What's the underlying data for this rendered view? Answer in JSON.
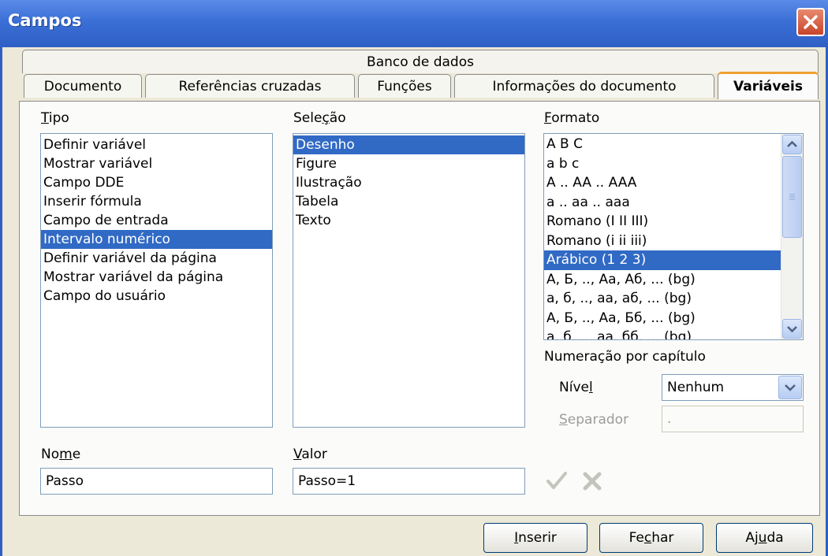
{
  "window": {
    "title": "Campos"
  },
  "tabs_top": [
    {
      "label": "Banco de dados"
    }
  ],
  "tabs": [
    {
      "label": "Documento"
    },
    {
      "label": "Referências cruzadas"
    },
    {
      "label": "Funções"
    },
    {
      "label": "Informações do documento"
    },
    {
      "label": "Variáveis",
      "active": true
    }
  ],
  "tipo": {
    "label_u": "T",
    "label_rest": "ipo",
    "items": [
      "Definir variável",
      "Mostrar variável",
      "Campo DDE",
      "Inserir fórmula",
      "Campo de entrada",
      "Intervalo numérico",
      "Definir variável da página",
      "Mostrar variável da página",
      "Campo do usuário"
    ],
    "selected_index": 5
  },
  "selecao": {
    "label_a": "Sele",
    "label_u": "ç",
    "label_b": "ão",
    "items": [
      "Desenho",
      "Figure",
      "Ilustração",
      "Tabela",
      "Texto"
    ],
    "selected_index": 0
  },
  "formato": {
    "label_u": "F",
    "label_rest": "ormato",
    "items": [
      "A B C",
      "a b c",
      "A .. AA .. AAA",
      "a .. aa .. aaa",
      "Romano (I II III)",
      "Romano (i ii iii)",
      "Arábico (1 2 3)",
      "А, Б, .., Аа, Аб, ... (bg)",
      "а, б, .., аа, аб, ... (bg)",
      "А, Б, .., Аа, Бб, ... (bg)",
      "а, б, .., аа, бб, ... (bg)"
    ],
    "selected_index": 6
  },
  "capitulo": {
    "heading": "Numeração por capítulo",
    "nivel_a": "Níve",
    "nivel_u": "l",
    "nivel_value": "Nenhum",
    "separador_u": "S",
    "separador_rest": "eparador",
    "separador_value": "."
  },
  "nome": {
    "label_a": "No",
    "label_u": "m",
    "label_b": "e",
    "value": "Passo"
  },
  "valor": {
    "label_u": "V",
    "label_rest": "alor",
    "value": "Passo=1"
  },
  "buttons": {
    "inserir_u": "I",
    "inserir_rest": "nserir",
    "fechar_a": "Fe",
    "fechar_u": "c",
    "fechar_b": "har",
    "ajuda_a": "Aj",
    "ajuda_u": "u",
    "ajuda_b": "da"
  },
  "icons": {
    "apply": "checkmark-icon",
    "delete": "close-icon",
    "window_close": "close-icon"
  },
  "colors": {
    "titlebar": "#3a6fd6",
    "selection": "#316ac5",
    "active_tab_accent": "#f0a030"
  }
}
